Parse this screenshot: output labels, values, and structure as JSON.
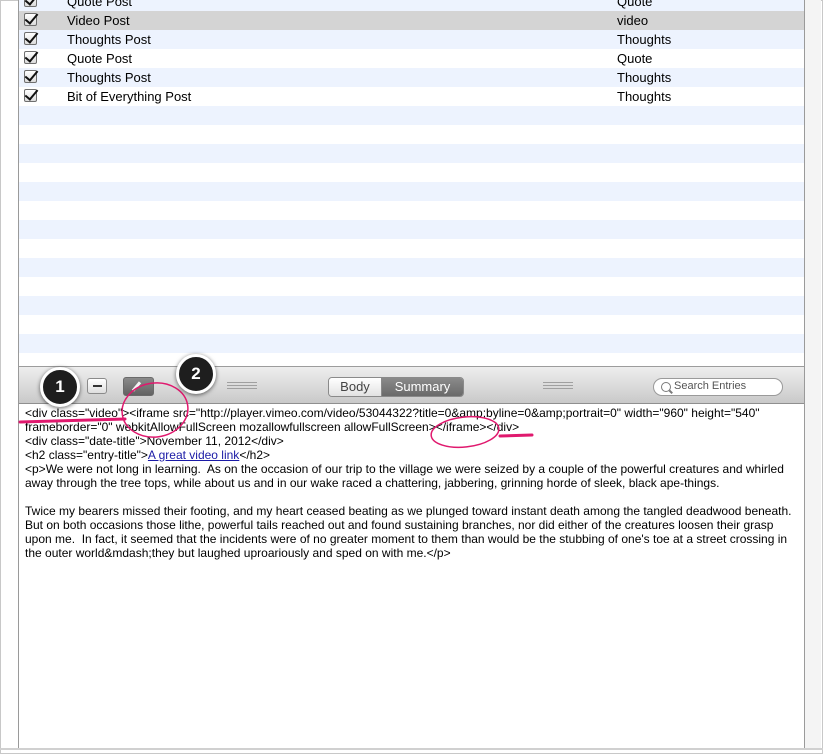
{
  "entries": [
    {
      "title": "Quote Post",
      "format": "Quote",
      "checked": true
    },
    {
      "title": "Video Post",
      "format": "video",
      "checked": true,
      "selected": true
    },
    {
      "title": "Thoughts Post",
      "format": "Thoughts",
      "checked": true
    },
    {
      "title": "Quote Post",
      "format": "Quote",
      "checked": true
    },
    {
      "title": "Thoughts Post",
      "format": "Thoughts",
      "checked": true
    },
    {
      "title": "Bit of Everything Post",
      "format": "Thoughts",
      "checked": true
    }
  ],
  "toolbar": {
    "body_label": "Body",
    "summary_label": "Summary",
    "selected_tab": "Summary",
    "search_placeholder": "Search Entries"
  },
  "editor": {
    "line1": "<div class=\"video\"><iframe src=\"http://player.vimeo.com/video/53044322?title=0&amp;byline=0&amp;portrait=0\" width=\"960\" height=\"540\"",
    "line2": "frameborder=\"0\" webkitAllowFullScreen mozallowfullscreen allowFullScreen></iframe></div>",
    "line3": "<div class=\"date-title\">November 11, 2012</div>",
    "line4_pre": "<h2 class=\"entry-title\">",
    "line4_link": "A great video link",
    "line4_post": "</h2>",
    "para1": "<p>We were not long in learning.  As on the occasion of our trip to the village we were seized by a couple of the powerful creatures and whirled away through the tree tops, while about us and in our wake raced a chattering, jabbering, grinning horde of sleek, black ape-things.",
    "para2": "Twice my bearers missed their footing, and my heart ceased beating as we plunged toward instant death among the tangled deadwood beneath. But on both occasions those lithe, powerful tails reached out and found sustaining branches, nor did either of the creatures loosen their grasp upon me.  In fact, it seemed that the incidents were of no greater moment to them than would be the stubbing of one's toe at a street crossing in the outer world&mdash;they but laughed uproariously and sped on with me.</p>"
  },
  "annotations": {
    "badge1": "1",
    "badge2": "2",
    "highlight_color": "#e0196e"
  }
}
